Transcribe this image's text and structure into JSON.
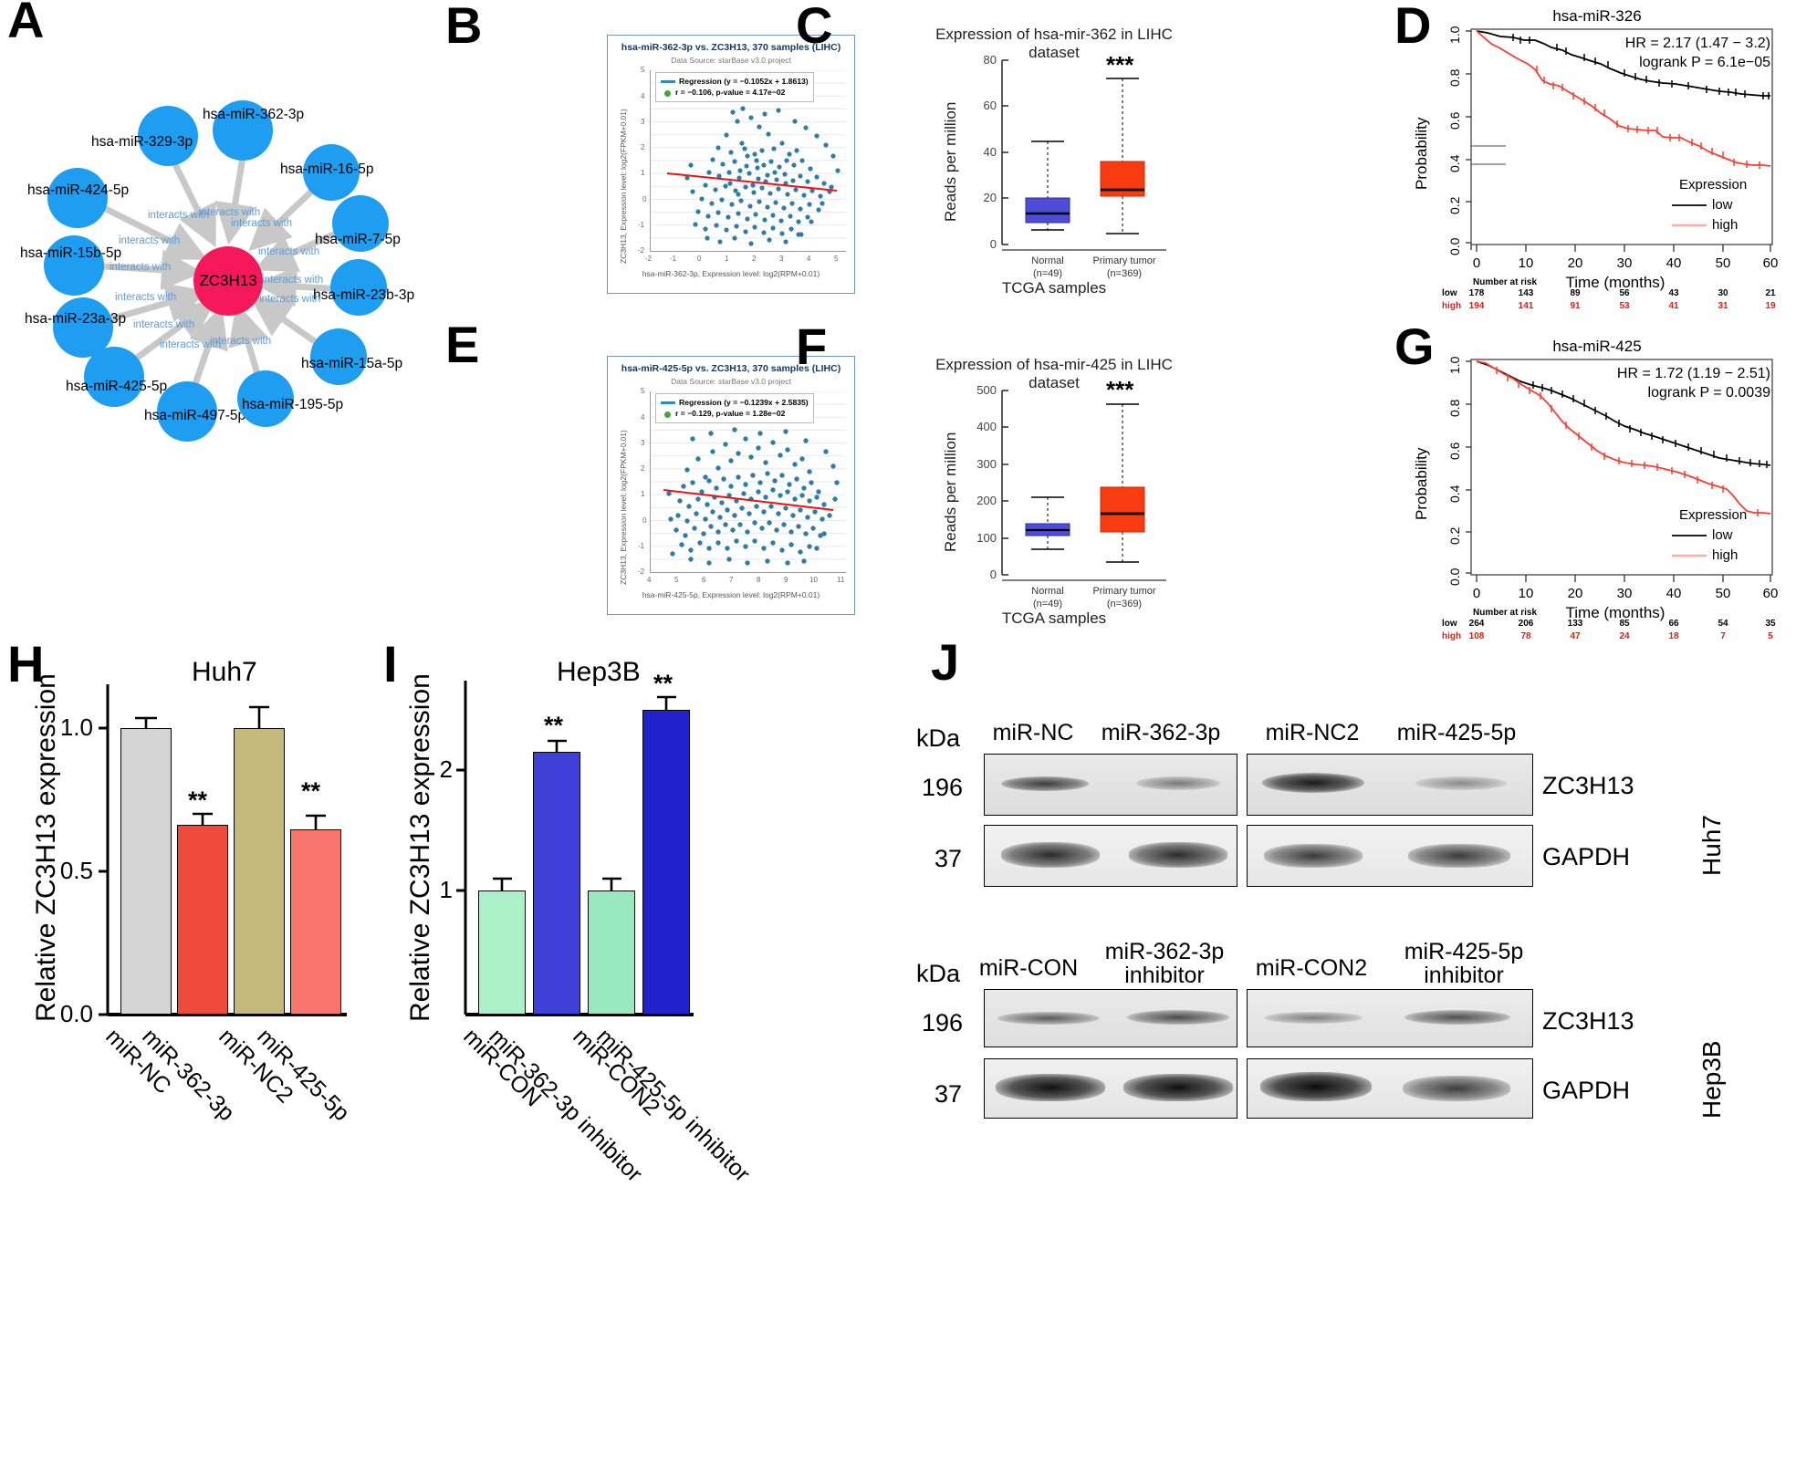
{
  "figure": {
    "panel_labels": [
      "A",
      "B",
      "C",
      "D",
      "E",
      "F",
      "G",
      "H",
      "I",
      "J"
    ]
  },
  "panelA": {
    "hub": "ZC3H13",
    "edge_label": "interacts with",
    "nodes": [
      {
        "label": "hsa-miR-329-3p"
      },
      {
        "label": "hsa-miR-362-3p"
      },
      {
        "label": "hsa-miR-16-5p"
      },
      {
        "label": "hsa-miR-424-5p"
      },
      {
        "label": "hsa-miR-7-5p"
      },
      {
        "label": "hsa-miR-15b-5p"
      },
      {
        "label": "hsa-miR-23b-3p"
      },
      {
        "label": "hsa-miR-23a-3p"
      },
      {
        "label": "hsa-miR-15a-5p"
      },
      {
        "label": "hsa-miR-425-5p"
      },
      {
        "label": "hsa-miR-497-5p"
      },
      {
        "label": "hsa-miR-195-5p"
      }
    ],
    "colors": {
      "node": "#1f9df0",
      "hub": "#f5185b",
      "edge": "#c8c8c8",
      "edge_label": "#5b9bd5"
    }
  },
  "chart_data": [
    {
      "id": "B",
      "type": "scatter",
      "title": "hsa-miR-362-3p vs. ZC3H13, 370 samples (LIHC)",
      "subtitle": "Data Source: starBase v3.0 project",
      "xlabel": "hsa-miR-362-3p, Expression level: log2(RPM+0.01)",
      "ylabel": "ZC3H13, Expression level: log2(FPKM+0.01)",
      "xlim": [
        -2,
        5
      ],
      "ylim": [
        -2,
        5
      ],
      "xticks": [
        -2,
        -1,
        0,
        1,
        2,
        3,
        4,
        5
      ],
      "yticks": [
        -2,
        -1,
        0,
        1,
        2,
        3,
        4,
        5
      ],
      "grid": true,
      "n_samples": 370,
      "legend": {
        "regression": "Regression (y = −0.1052x + 1.8613)",
        "correlation": "r = −0.106, p-value = 4.17e−02",
        "position": "top-left"
      },
      "regression": {
        "slope": -0.1052,
        "intercept": 1.8613,
        "r": -0.106,
        "p_value": "4.17e-02",
        "color": "#ee1111"
      },
      "point_color": "#2e7da8"
    },
    {
      "id": "C",
      "type": "box",
      "title": "Expression of hsa-mir-362 in LIHC dataset",
      "xlabel": "TCGA samples",
      "ylabel": "Reads per million",
      "ylim": [
        0,
        80
      ],
      "yticks": [
        0,
        20,
        40,
        60,
        80
      ],
      "significance": "***",
      "groups": [
        {
          "name": "Normal",
          "n": 49,
          "color": "#4d4dd8",
          "whisker_low": 6.0,
          "q1": 9.5,
          "median": 13.5,
          "q3": 22.0,
          "whisker_high": 44.5
        },
        {
          "name": "Primary tumor",
          "n": 369,
          "color": "#f83b10",
          "whisker_low": 4.5,
          "q1": 15.0,
          "median": 23.5,
          "q3": 36.0,
          "whisker_high": 72.0
        }
      ],
      "category_labels": [
        "Normal\n(n=49)",
        "Primary tumor\n(n=369)"
      ]
    },
    {
      "id": "D",
      "type": "line",
      "subtype": "kaplan-meier",
      "title": "hsa-miR-326",
      "xlabel": "Time (months)",
      "ylabel": "Probability",
      "xlim": [
        0,
        60
      ],
      "ylim": [
        0,
        1
      ],
      "xticks": [
        0,
        10,
        20,
        30,
        40,
        50,
        60
      ],
      "yticks": [
        "0.0",
        "0.2",
        "0.4",
        "0.6",
        "0.8",
        "1.0"
      ],
      "annotations": [
        "HR = 2.17 (1.47 − 3.2)",
        "logrank P = 6.1e−05"
      ],
      "legend_title": "Expression",
      "series": [
        {
          "name": "low",
          "color": "#000000",
          "x": [
            0,
            5,
            10,
            14,
            17,
            20,
            24,
            28,
            31,
            36,
            40,
            45,
            50,
            54,
            60
          ],
          "y": [
            1.0,
            0.96,
            0.95,
            0.9,
            0.88,
            0.85,
            0.8,
            0.78,
            0.75,
            0.74,
            0.7,
            0.68,
            0.67,
            0.65,
            0.64
          ]
        },
        {
          "name": "high",
          "color": "#ff3b30",
          "x": [
            0,
            4,
            8,
            12,
            14,
            16,
            20,
            24,
            27,
            31,
            36,
            40,
            45,
            50,
            55,
            60
          ],
          "y": [
            1.0,
            0.92,
            0.87,
            0.8,
            0.76,
            0.72,
            0.7,
            0.64,
            0.58,
            0.56,
            0.55,
            0.51,
            0.5,
            0.45,
            0.4,
            0.37
          ]
        }
      ],
      "risk_table": {
        "header": "Number at risk",
        "row_labels": [
          "low",
          "high"
        ],
        "times": [
          0,
          10,
          20,
          30,
          40,
          50,
          60
        ],
        "low": [
          178,
          143,
          89,
          56,
          43,
          30,
          21
        ],
        "high": [
          194,
          141,
          91,
          53,
          41,
          31,
          19
        ]
      }
    },
    {
      "id": "E",
      "type": "scatter",
      "title": "hsa-miR-425-5p vs. ZC3H13, 370 samples (LIHC)",
      "subtitle": "Data Source: starBase v3.0 project",
      "xlabel": "hsa-miR-425-5p, Expression level: log2(RPM+0.01)",
      "ylabel": "ZC3H13, Expression level: log2(FPKM+0.01)",
      "xlim": [
        4,
        11
      ],
      "ylim": [
        -2,
        5
      ],
      "xticks": [
        4,
        5,
        6,
        7,
        8,
        9,
        10,
        11
      ],
      "yticks": [
        -2,
        -1,
        0,
        1,
        2,
        3,
        4,
        5
      ],
      "grid": true,
      "n_samples": 370,
      "legend": {
        "regression": "Regression (y = −0.1239x + 2.5835)",
        "correlation": "r = −0.129, p-value = 1.28e−02",
        "position": "top-left"
      },
      "regression": {
        "slope": -0.1239,
        "intercept": 2.5835,
        "r": -0.129,
        "p_value": "1.28e-02",
        "color": "#ee1111"
      },
      "point_color": "#2e7da8"
    },
    {
      "id": "F",
      "type": "box",
      "title": "Expression of hsa-mir-425 in LIHC dataset",
      "xlabel": "TCGA samples",
      "ylabel": "Reads per million",
      "ylim": [
        0,
        500
      ],
      "yticks": [
        0,
        100,
        200,
        300,
        400,
        500
      ],
      "significance": "***",
      "groups": [
        {
          "name": "Normal",
          "n": 49,
          "color": "#4d4dd8",
          "whisker_low": 70,
          "q1": 97,
          "median": 110,
          "q3": 128,
          "whisker_high": 210
        },
        {
          "name": "Primary tumor",
          "n": 369,
          "color": "#f83b10",
          "whisker_low": 35,
          "q1": 115,
          "median": 165,
          "q3": 237,
          "whisker_high": 463
        }
      ],
      "category_labels": [
        "Normal\n(n=49)",
        "Primary tumor\n(n=369)"
      ]
    },
    {
      "id": "G",
      "type": "line",
      "subtype": "kaplan-meier",
      "title": "hsa-miR-425",
      "xlabel": "Time (months)",
      "ylabel": "Probability",
      "xlim": [
        0,
        60
      ],
      "ylim": [
        0,
        1
      ],
      "xticks": [
        0,
        10,
        20,
        30,
        40,
        50,
        60
      ],
      "yticks": [
        "0.0",
        "0.2",
        "0.4",
        "0.6",
        "0.8",
        "1.0"
      ],
      "annotations": [
        "HR = 1.72 (1.19 − 2.51)",
        "logrank P = 0.0039"
      ],
      "legend_title": "Expression",
      "series": [
        {
          "name": "low",
          "color": "#000000",
          "x": [
            0,
            5,
            10,
            15,
            18,
            20,
            24,
            28,
            32,
            36,
            40,
            45,
            50,
            55,
            60
          ],
          "y": [
            1.0,
            0.95,
            0.9,
            0.86,
            0.84,
            0.82,
            0.78,
            0.72,
            0.68,
            0.65,
            0.62,
            0.58,
            0.55,
            0.52,
            0.51
          ]
        },
        {
          "name": "high",
          "color": "#ff3b30",
          "x": [
            0,
            4,
            8,
            12,
            16,
            20,
            22,
            26,
            30,
            34,
            40,
            45,
            50,
            53,
            57,
            60
          ],
          "y": [
            1.0,
            0.96,
            0.9,
            0.86,
            0.82,
            0.78,
            0.7,
            0.62,
            0.56,
            0.52,
            0.5,
            0.48,
            0.45,
            0.4,
            0.31,
            0.3
          ]
        }
      ],
      "risk_table": {
        "header": "Number at risk",
        "row_labels": [
          "low",
          "high"
        ],
        "times": [
          0,
          10,
          20,
          30,
          40,
          50,
          60
        ],
        "low": [
          264,
          206,
          133,
          85,
          66,
          54,
          35
        ],
        "high": [
          108,
          78,
          47,
          24,
          18,
          7,
          5
        ]
      }
    },
    {
      "id": "H",
      "type": "bar",
      "title": "Huh7",
      "ylabel": "Relative ZC3H13 expression",
      "ylim": [
        0.0,
        1.15
      ],
      "yticks": [
        "0.0",
        "0.5",
        "1.0"
      ],
      "categories": [
        "miR-NC",
        "miR-362-3p",
        "miR-NC2",
        "miR-425-5p"
      ],
      "values": [
        1.0,
        0.675,
        1.0,
        0.665
      ],
      "errors": [
        0.035,
        0.025,
        0.075,
        0.04
      ],
      "colors": [
        "#d4d4d4",
        "#f04a3c",
        "#c2b97a",
        "#f8766d"
      ],
      "significance": [
        "",
        "**",
        "",
        "**"
      ]
    },
    {
      "id": "I",
      "type": "bar",
      "title": "Hep3B",
      "ylabel": "Relative ZC3H13 expression",
      "ylim": [
        0.0,
        2.75
      ],
      "yticks": [
        "1",
        "2"
      ],
      "categories": [
        "miR-CON",
        "miR-362-3p inhibitor",
        "miR-CON2",
        "miR-425-5p inhibitor"
      ],
      "values": [
        1.01,
        2.19,
        1.01,
        2.55
      ],
      "errors": [
        0.05,
        0.04,
        0.05,
        0.06
      ],
      "colors": [
        "#aaf0c8",
        "#3f40d8",
        "#9ae8c0",
        "#2222cc"
      ],
      "significance": [
        "",
        "**",
        "",
        "**"
      ]
    }
  ],
  "panelJ": {
    "blocks": [
      {
        "cell_line": "Huh7",
        "kda_label": "kDa",
        "lane_groups": [
          {
            "lanes": [
              "miR-NC",
              "miR-362-3p"
            ]
          },
          {
            "lanes": [
              "miR-NC2",
              "miR-425-5p"
            ]
          }
        ],
        "rows": [
          {
            "mw": "196",
            "protein": "ZC3H13"
          },
          {
            "mw": "37",
            "protein": "GAPDH"
          }
        ]
      },
      {
        "cell_line": "Hep3B",
        "kda_label": "kDa",
        "lane_groups": [
          {
            "lanes": [
              "miR-CON",
              "miR-362-3p\ninhibitor"
            ]
          },
          {
            "lanes": [
              "miR-CON2",
              "miR-425-5p\ninhibitor"
            ]
          }
        ],
        "rows": [
          {
            "mw": "196",
            "protein": "ZC3H13"
          },
          {
            "mw": "37",
            "protein": "GAPDH"
          }
        ]
      }
    ]
  }
}
